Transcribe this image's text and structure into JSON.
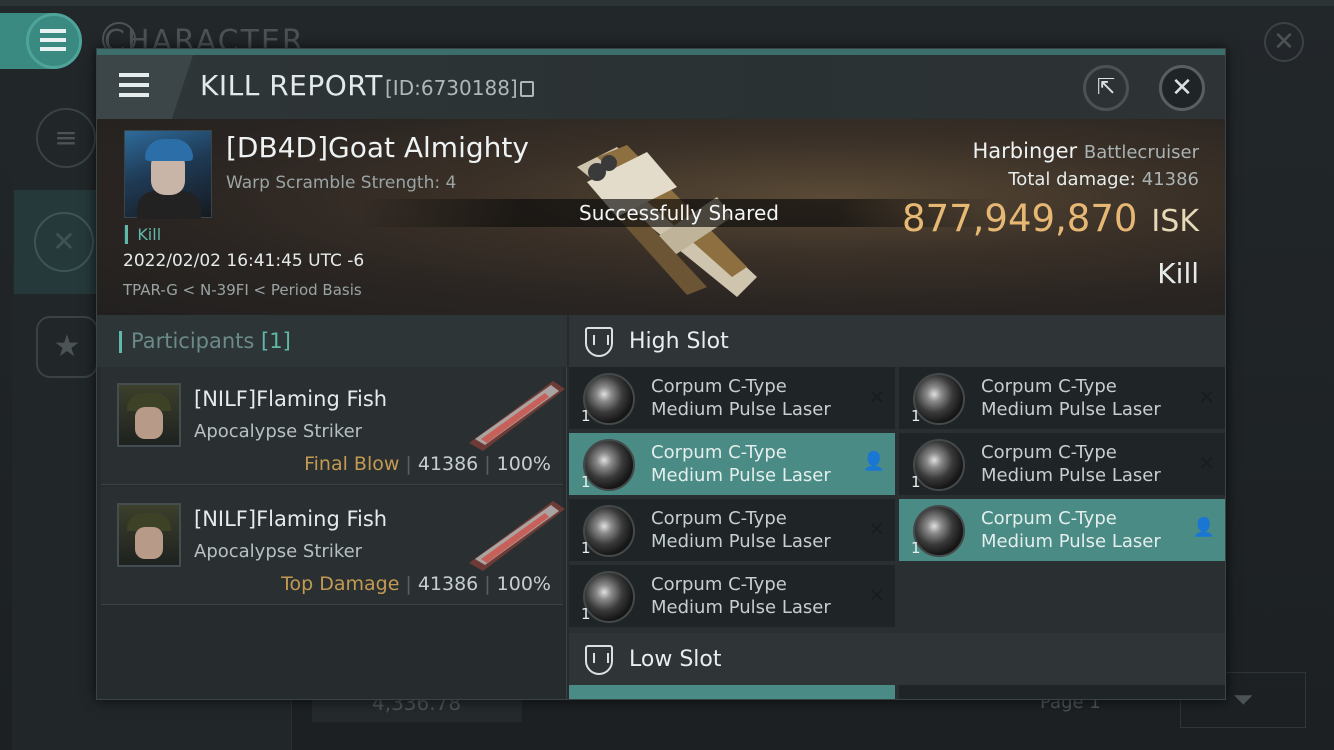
{
  "background": {
    "section_title": "CHARACTER",
    "money": "4,336.78",
    "page_label": "Page 1"
  },
  "header": {
    "title": "KILL REPORT",
    "report_id": "[ID:6730188]"
  },
  "victim": {
    "name": "[DB4D]Goat Almighty",
    "warp_scramble": "Warp Scramble Strength: 4",
    "kill_tag": "Kill",
    "datetime": "2022/02/02 16:41:45 UTC -6",
    "location": "TPAR-G < N-39FI < Period Basis",
    "toast": "Successfully Shared",
    "ship_name": "Harbinger",
    "ship_class": "Battlecruiser",
    "total_damage_label": "Total damage:",
    "total_damage": "41386",
    "isk_value": "877,949,870",
    "isk_unit": "ISK",
    "report_type": "Kill"
  },
  "participants": {
    "label": "Participants",
    "count": "[1]",
    "rows": [
      {
        "name": "[NILF]Flaming Fish",
        "ship": "Apocalypse Striker",
        "tag": "Final Blow",
        "damage": "41386",
        "percent": "100%"
      },
      {
        "name": "[NILF]Flaming Fish",
        "ship": "Apocalypse Striker",
        "tag": "Top Damage",
        "damage": "41386",
        "percent": "100%"
      }
    ]
  },
  "slots": {
    "high_label": "High Slot",
    "low_label": "Low Slot",
    "high_items": [
      {
        "qty": "1",
        "line1": "Corpum C-Type",
        "line2": "Medium Pulse Laser",
        "status": "destroyed"
      },
      {
        "qty": "1",
        "line1": "Corpum C-Type",
        "line2": "Medium Pulse Laser",
        "status": "destroyed"
      },
      {
        "qty": "1",
        "line1": "Corpum C-Type",
        "line2": "Medium Pulse Laser",
        "status": "dropped"
      },
      {
        "qty": "1",
        "line1": "Corpum C-Type",
        "line2": "Medium Pulse Laser",
        "status": "destroyed"
      },
      {
        "qty": "1",
        "line1": "Corpum C-Type",
        "line2": "Medium Pulse Laser",
        "status": "destroyed"
      },
      {
        "qty": "1",
        "line1": "Corpum C-Type",
        "line2": "Medium Pulse Laser",
        "status": "dropped"
      },
      {
        "qty": "1",
        "line1": "Corpum C-Type",
        "line2": "Medium Pulse Laser",
        "status": "destroyed"
      }
    ]
  },
  "colors": {
    "accent_teal": "#5fb8a8",
    "isk_gold": "#e7b874",
    "tag_gold": "#c49a52",
    "dropped_highlight": "#4a8c85"
  },
  "icons": {
    "destroyed": "close-icon",
    "dropped": "person-icon"
  }
}
